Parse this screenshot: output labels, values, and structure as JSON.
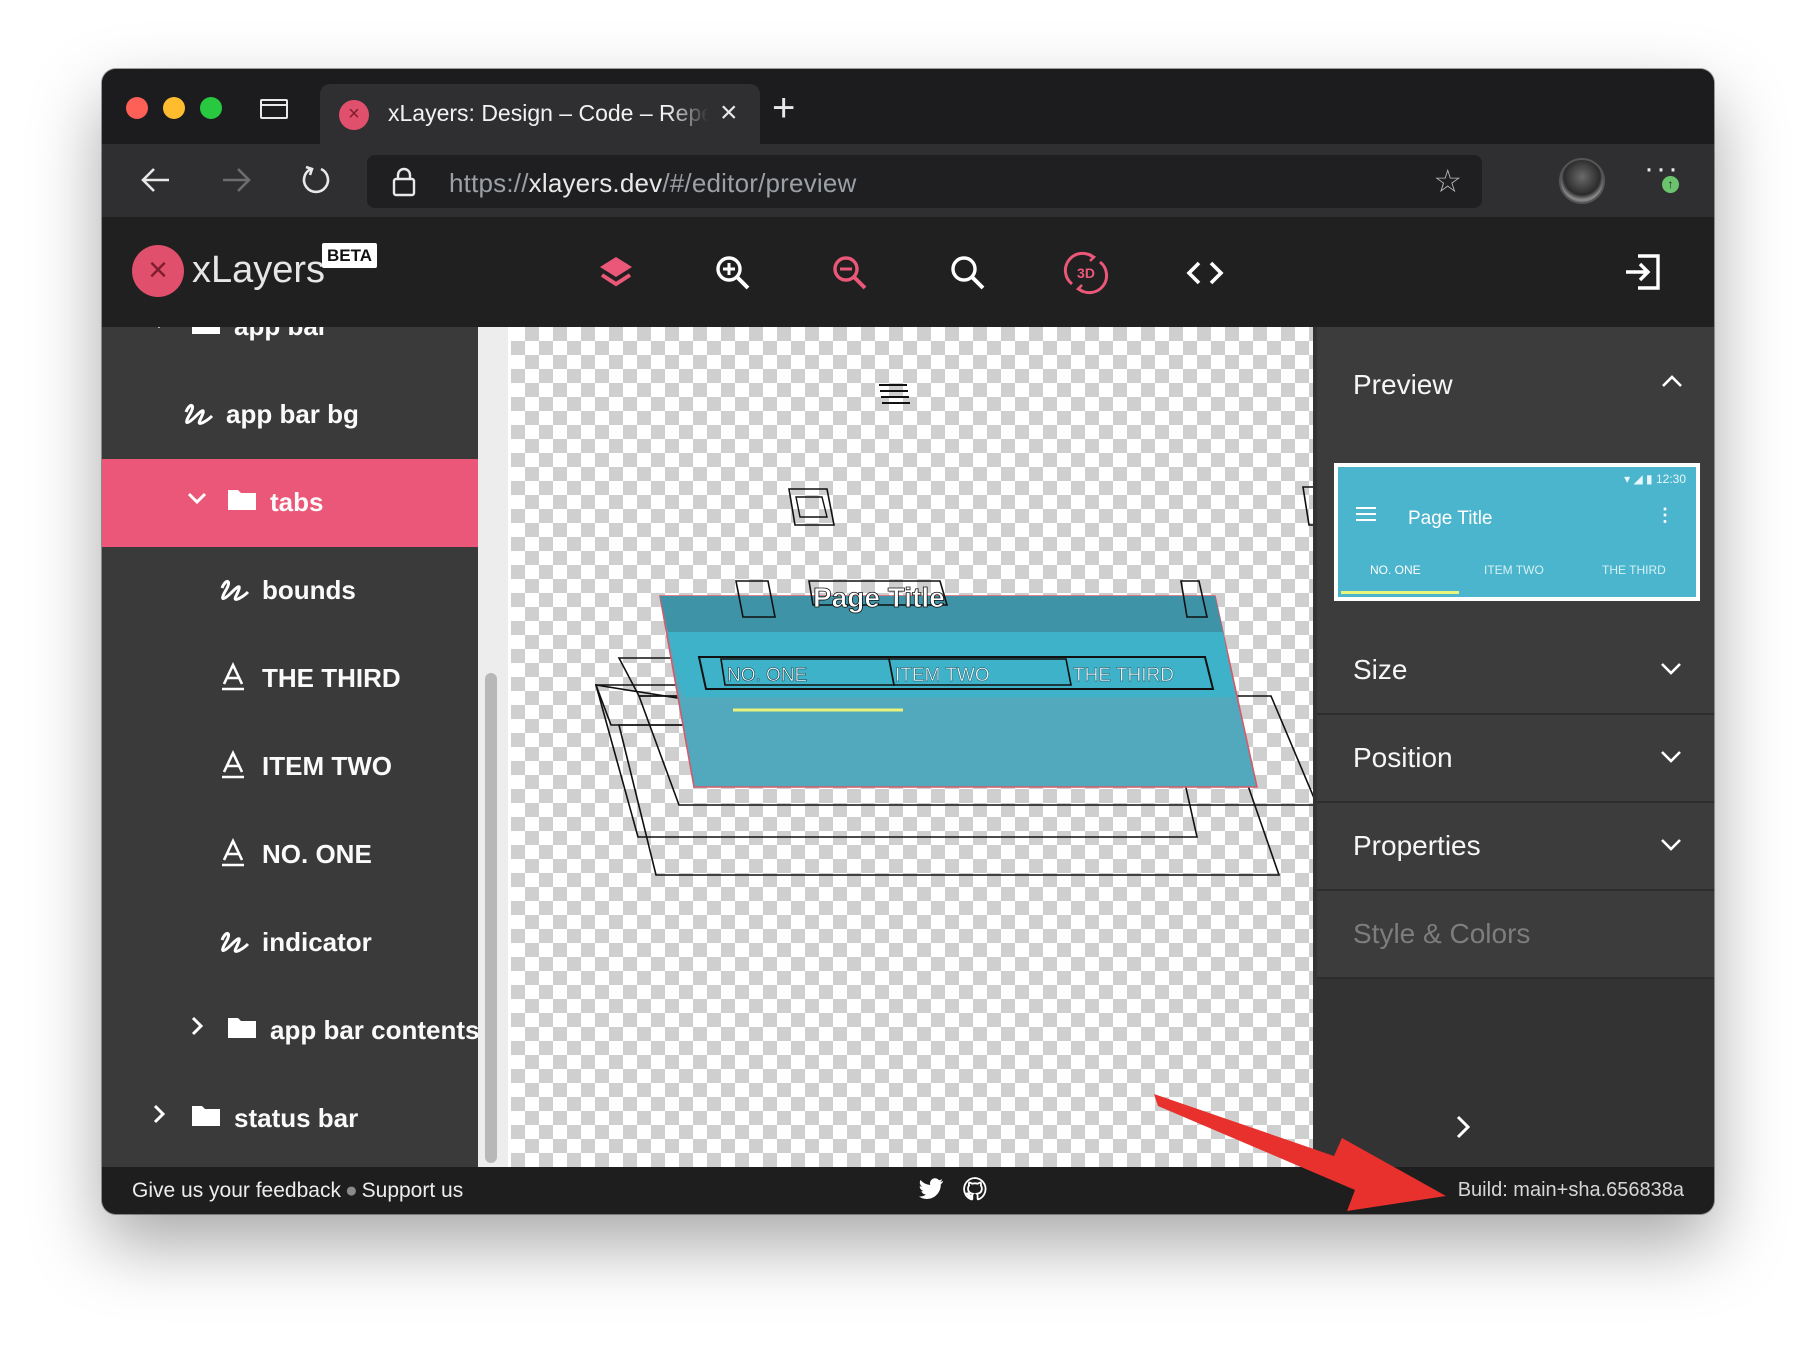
{
  "browser": {
    "tab_title": "xLayers: Design – Code – Repe",
    "url_scheme": "https://",
    "url_host": "xlayers.dev",
    "url_path": "/#/editor/preview"
  },
  "app": {
    "logo_text": "xLayers",
    "beta_label": "BETA",
    "accent_color": "#ea5778"
  },
  "layers": [
    {
      "label": "app bar",
      "kind": "folder",
      "expanded": true
    },
    {
      "label": "app bar bg",
      "kind": "shape"
    },
    {
      "label": "tabs",
      "kind": "folder",
      "expanded": true,
      "selected": true
    },
    {
      "label": "bounds",
      "kind": "shape"
    },
    {
      "label": "THE THIRD",
      "kind": "text"
    },
    {
      "label": "ITEM TWO",
      "kind": "text"
    },
    {
      "label": "NO. ONE",
      "kind": "text"
    },
    {
      "label": "indicator",
      "kind": "shape"
    },
    {
      "label": "app bar contents",
      "kind": "folder",
      "expanded": false
    },
    {
      "label": "status bar",
      "kind": "folder",
      "expanded": false
    }
  ],
  "canvas": {
    "page_title": "Page Title",
    "tab_labels": [
      "NO. ONE",
      "ITEM TWO",
      "THE THIRD"
    ]
  },
  "panel": {
    "preview_title": "Preview",
    "preview": {
      "time": "12:30",
      "page_title": "Page Title",
      "tabs": [
        "NO. ONE",
        "ITEM TWO",
        "THE THIRD"
      ]
    },
    "sections": [
      "Size",
      "Position",
      "Properties"
    ],
    "style_colors": "Style & Colors"
  },
  "footer": {
    "feedback": "Give us your feedback",
    "support": "Support us",
    "build": "Build: main+sha.656838a"
  }
}
